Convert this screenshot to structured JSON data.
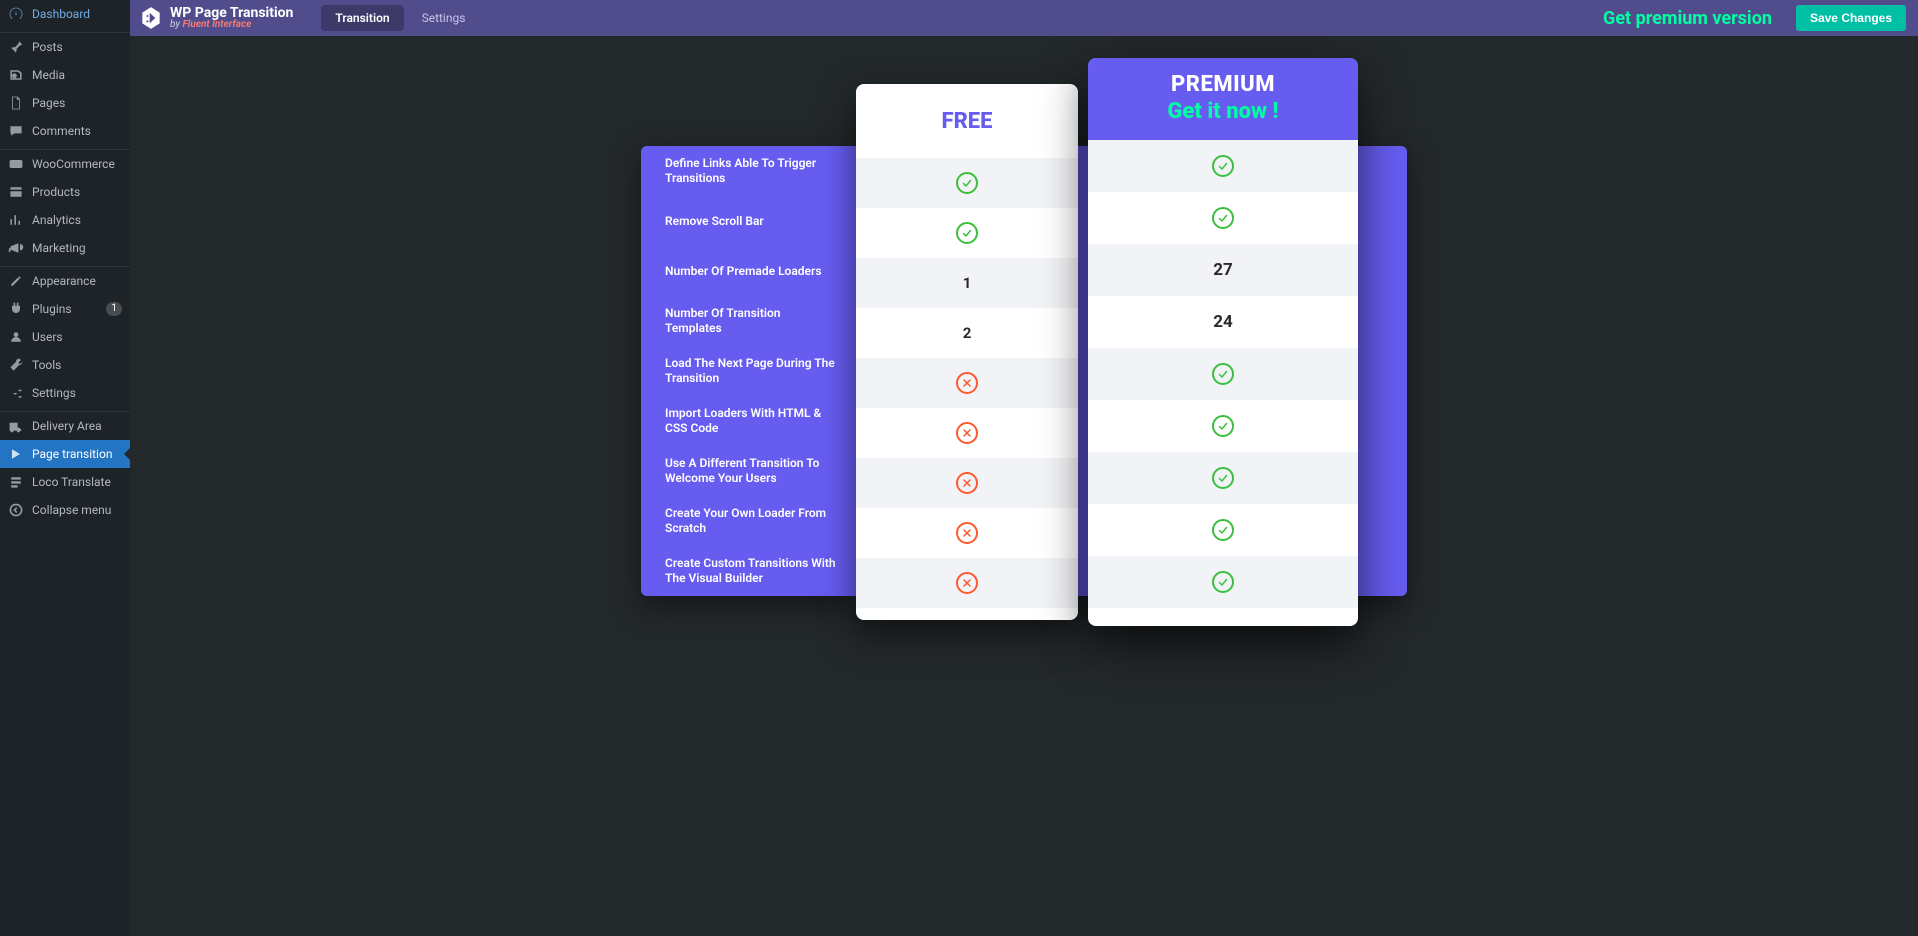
{
  "sidebar": {
    "items": [
      {
        "icon": "dashboard",
        "label": "Dashboard"
      },
      {
        "sep": true
      },
      {
        "icon": "pin",
        "label": "Posts"
      },
      {
        "icon": "media",
        "label": "Media"
      },
      {
        "icon": "page",
        "label": "Pages"
      },
      {
        "icon": "comment",
        "label": "Comments"
      },
      {
        "sep": true
      },
      {
        "icon": "woo",
        "label": "WooCommerce"
      },
      {
        "icon": "products",
        "label": "Products"
      },
      {
        "icon": "analytics",
        "label": "Analytics"
      },
      {
        "icon": "marketing",
        "label": "Marketing"
      },
      {
        "sep": true
      },
      {
        "icon": "appearance",
        "label": "Appearance"
      },
      {
        "icon": "plugins",
        "label": "Plugins",
        "badge": "1"
      },
      {
        "icon": "users",
        "label": "Users"
      },
      {
        "icon": "tools",
        "label": "Tools"
      },
      {
        "icon": "settings",
        "label": "Settings"
      },
      {
        "sep": true
      },
      {
        "icon": "delivery",
        "label": "Delivery Area"
      },
      {
        "icon": "transition",
        "label": "Page transition",
        "active": true
      },
      {
        "icon": "loco",
        "label": "Loco Translate"
      },
      {
        "icon": "collapse",
        "label": "Collapse menu"
      }
    ]
  },
  "topbar": {
    "title": "WP Page Transition",
    "by": "by",
    "brand": "Fluent Interface",
    "tabs": [
      "Transition",
      "Settings"
    ],
    "active_tab": 0,
    "premium_cta": "Get premium version",
    "save": "Save Changes"
  },
  "compare": {
    "features": [
      "Define Links Able To Trigger Transitions",
      "Remove Scroll Bar",
      "Number Of Premade Loaders",
      "Number Of Transition Templates",
      "Load The Next Page During The Transition",
      "Import Loaders With HTML & CSS Code",
      "Use A Different Transition To Welcome Your Users",
      "Create Your Own Loader From Scratch",
      "Create Custom Transitions With The Visual Builder"
    ],
    "free": {
      "title": "FREE",
      "values": [
        "yes",
        "yes",
        "1",
        "2",
        "no",
        "no",
        "no",
        "no",
        "no"
      ]
    },
    "premium": {
      "title": "PREMIUM",
      "subtitle": "Get it now !",
      "values": [
        "yes",
        "yes",
        "27",
        "24",
        "yes",
        "yes",
        "yes",
        "yes",
        "yes"
      ]
    }
  }
}
